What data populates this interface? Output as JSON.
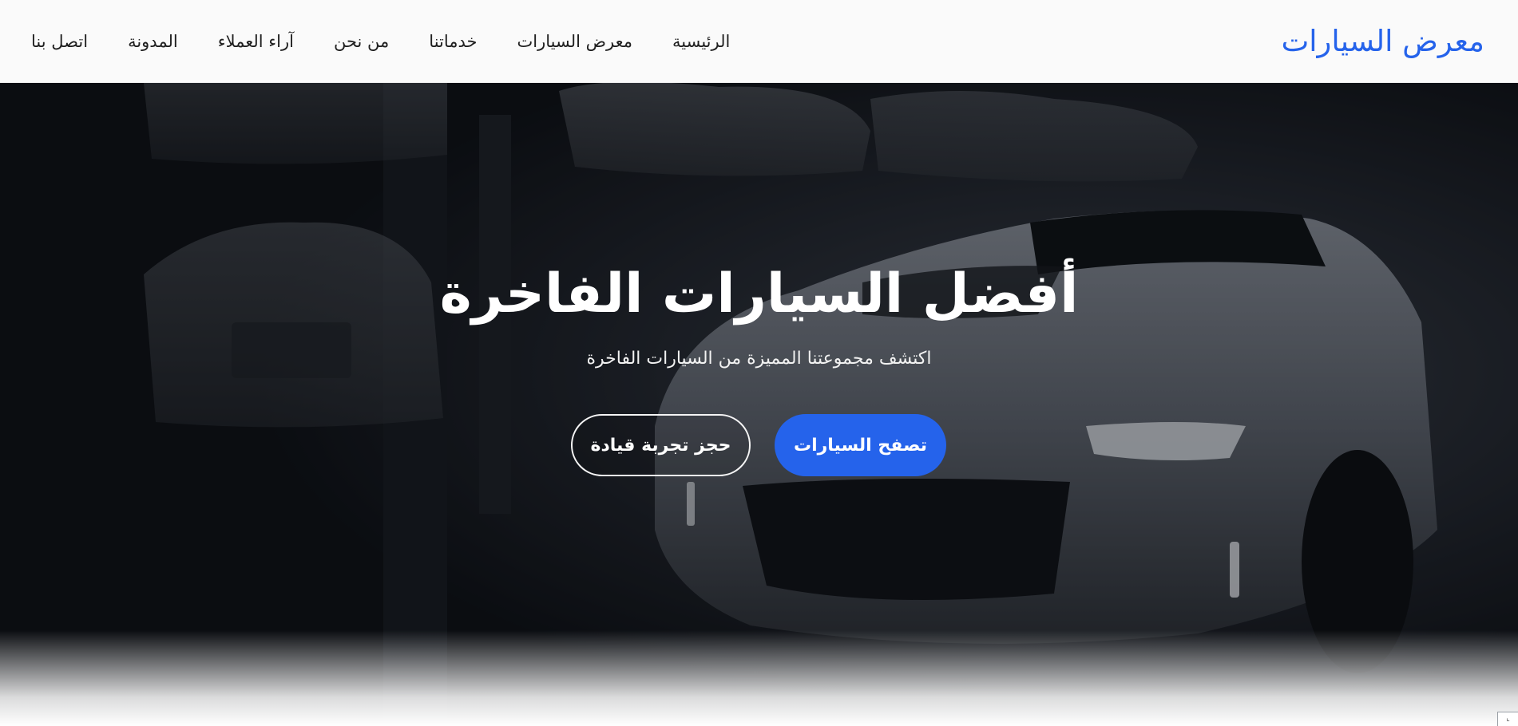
{
  "header": {
    "brand": "معرض السيارات",
    "nav": [
      {
        "label": "الرئيسية"
      },
      {
        "label": "معرض السيارات"
      },
      {
        "label": "خدماتنا"
      },
      {
        "label": "من نحن"
      },
      {
        "label": "آراء العملاء"
      },
      {
        "label": "المدونة"
      },
      {
        "label": "اتصل بنا"
      }
    ]
  },
  "hero": {
    "title": "أفضل السيارات الفاخرة",
    "subtitle": "اكتشف مجموعتنا المميزة من السيارات الفاخرة",
    "primary_button": "تصفح السيارات",
    "secondary_button": "حجز تجربة قيادة"
  },
  "colors": {
    "accent": "#2563eb",
    "header_bg": "#fafafa",
    "hero_overlay": "#0b0d12"
  }
}
